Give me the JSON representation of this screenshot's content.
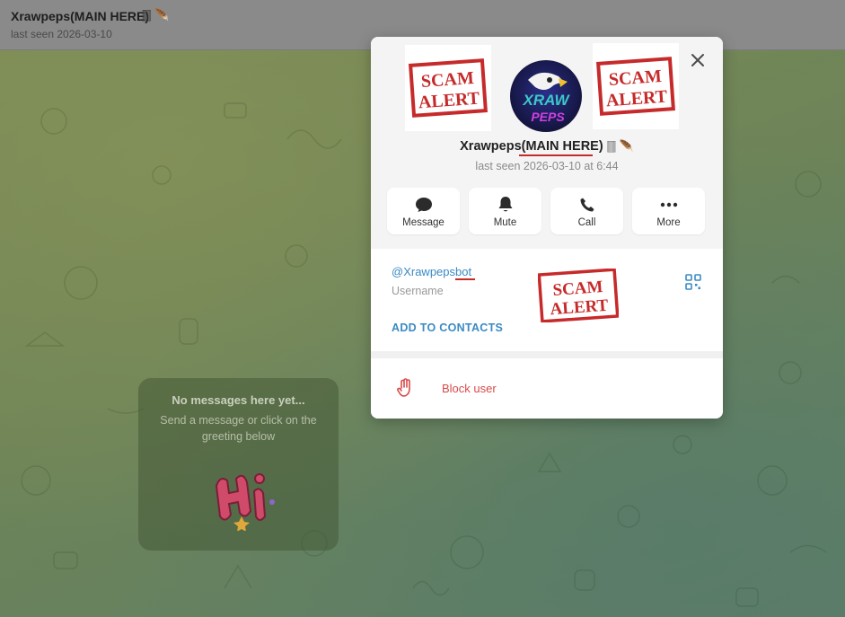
{
  "header": {
    "title": "Xrawpeps(MAIN HERE)",
    "title_icons": "🀫 🪶",
    "subtitle": "last seen 2026-03-10"
  },
  "empty_chat": {
    "title": "No messages here yet...",
    "text": "Send a message or click on the greeting below"
  },
  "profile": {
    "name": "Xrawpeps(MAIN HERE)",
    "name_icons": "🀫 🪶",
    "last_seen": "last seen 2026-03-10 at 6:44",
    "scam_alert_text": "SCAM ALERT",
    "avatar_text_top": "XRAW",
    "avatar_text_bottom": "PEPS",
    "actions": [
      {
        "label": "Message",
        "icon": "chat-bubble-icon"
      },
      {
        "label": "Mute",
        "icon": "bell-icon"
      },
      {
        "label": "Call",
        "icon": "phone-icon"
      },
      {
        "label": "More",
        "icon": "more-dots-icon"
      }
    ],
    "username": "@Xrawpepsbot",
    "username_label": "Username",
    "add_to_contacts": "ADD TO CONTACTS",
    "block_user": "Block user"
  },
  "colors": {
    "link": "#3a8ac4",
    "danger": "#d94a4a",
    "scam_red": "#c62a2a"
  }
}
